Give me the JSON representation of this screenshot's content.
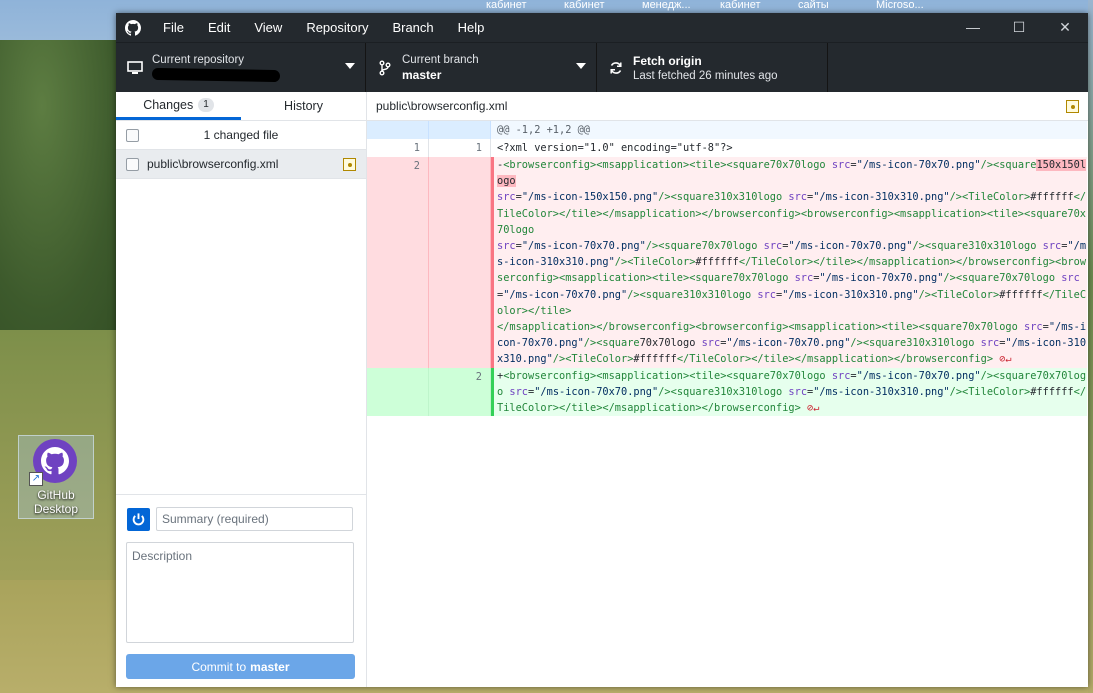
{
  "taskbar": [
    "кабинет",
    "кабинет",
    "менедж...",
    "кабинет",
    "сайты",
    "Microso..."
  ],
  "desktop_icon": {
    "label": "GitHub Desktop"
  },
  "menu": [
    "File",
    "Edit",
    "View",
    "Repository",
    "Branch",
    "Help"
  ],
  "window_controls": {
    "minimize": "—",
    "maximize": "☐",
    "close": "✕"
  },
  "toolbar": {
    "repo_label": "Current repository",
    "branch_label": "Current branch",
    "branch_value": "master",
    "fetch_label": "Fetch origin",
    "fetch_sub": "Last fetched 26 minutes ago"
  },
  "tabs": {
    "changes": "Changes",
    "changes_count": "1",
    "history": "History"
  },
  "changes": {
    "header": "1 changed file",
    "files": [
      {
        "path": "public\\browserconfig.xml"
      }
    ]
  },
  "commit": {
    "summary_placeholder": "Summary (required)",
    "description_placeholder": "Description",
    "button_prefix": "Commit to",
    "button_branch": "master"
  },
  "diff": {
    "path": "public\\browserconfig.xml",
    "hunk": "@@ -1,2 +1,2 @@",
    "context_line": {
      "old": "1",
      "new": "1",
      "text": "<?xml version=\"1.0\" encoding=\"utf-8\"?>"
    },
    "deleted_line": {
      "old": "2"
    },
    "added_line": {
      "new": "2"
    }
  },
  "colors": {
    "accent": "#0366d6",
    "titlebar": "#24292e",
    "commit_button": "#6ba6e8",
    "deleted": "#ffeef0",
    "added": "#e6ffed"
  }
}
